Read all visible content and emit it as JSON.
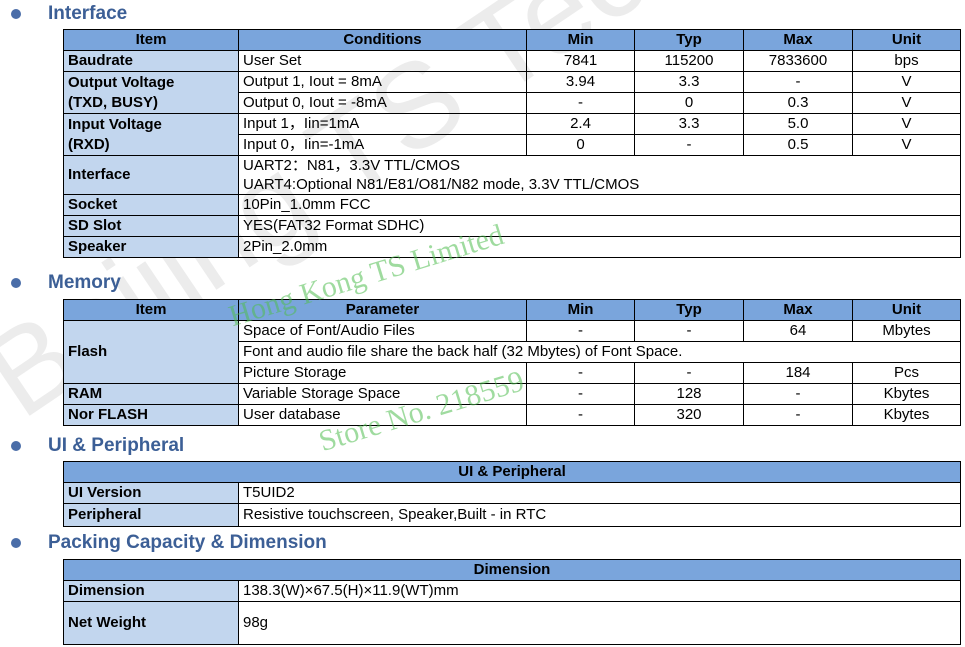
{
  "sections": {
    "interface": "Interface",
    "memory": "Memory",
    "ui": "UI & Peripheral",
    "packing": "Packing Capacity & Dimension"
  },
  "interface_table": {
    "headers": [
      "Item",
      "Conditions",
      "Min",
      "Typ",
      "Max",
      "Unit"
    ],
    "baudrate": {
      "item": "Baudrate",
      "cond": "User Set",
      "min": "7841",
      "typ": "115200",
      "max": "7833600",
      "unit": "bps"
    },
    "output_voltage": {
      "item_line1": "Output Voltage",
      "item_line2": "(TXD, BUSY)",
      "rows": [
        {
          "cond": "Output 1, Iout = 8mA",
          "min": "3.94",
          "typ": "3.3",
          "max": "-",
          "unit": "V"
        },
        {
          "cond": "Output 0, Iout = -8mA",
          "min": "-",
          "typ": "0",
          "max": "0.3",
          "unit": "V"
        }
      ]
    },
    "input_voltage": {
      "item_line1": "Input Voltage",
      "item_line2": "(RXD)",
      "rows": [
        {
          "cond": "Input 1，Iin=1mA",
          "min": "2.4",
          "typ": "3.3",
          "max": "5.0",
          "unit": "V"
        },
        {
          "cond": "Input 0，Iin=-1mA",
          "min": "0",
          "typ": "-",
          "max": "0.5",
          "unit": "V"
        }
      ]
    },
    "interface_row": {
      "item": "Interface",
      "line1": "UART2：N81，3.3V TTL/CMOS",
      "line2": "UART4:Optional N81/E81/O81/N82 mode, 3.3V TTL/CMOS"
    },
    "socket": {
      "item": "Socket",
      "value": "10Pin_1.0mm FCC"
    },
    "sd_slot": {
      "item": "SD Slot",
      "value": "YES(FAT32 Format SDHC)"
    },
    "speaker": {
      "item": "Speaker",
      "value": "2Pin_2.0mm"
    }
  },
  "memory_table": {
    "headers": [
      "Item",
      "Parameter",
      "Min",
      "Typ",
      "Max",
      "Unit"
    ],
    "flash": {
      "item": "Flash",
      "row1": {
        "param": "Space of Font/Audio Files",
        "min": "-",
        "typ": "-",
        "max": "64",
        "unit": "Mbytes"
      },
      "note": "Font and audio file share the back half (32 Mbytes) of Font Space.",
      "row3": {
        "param": "Picture Storage",
        "min": "-",
        "typ": "-",
        "max": "184",
        "unit": "Pcs"
      }
    },
    "ram": {
      "item": "RAM",
      "param": "Variable Storage Space",
      "min": "-",
      "typ": "128",
      "max": "-",
      "unit": "Kbytes"
    },
    "nor": {
      "item": "Nor FLASH",
      "param": "User database",
      "min": "-",
      "typ": "320",
      "max": "-",
      "unit": "Kbytes"
    }
  },
  "ui_table": {
    "band": "UI & Peripheral",
    "version": {
      "item": "UI Version",
      "value": "T5UID2"
    },
    "peripheral": {
      "item": "Peripheral",
      "value": "Resistive touchscreen, Speaker,Built - in RTC"
    }
  },
  "packing_table": {
    "band": "Dimension",
    "dimension": {
      "item": "Dimension",
      "value": "138.3(W)×67.5(H)×11.9(WT)mm"
    },
    "weight": {
      "item": "Net Weight",
      "value": "98g"
    }
  },
  "watermarks": {
    "line1": "Hong Kong TS Limited",
    "line2": "Store No. 218559",
    "background": "Beijing TS Technology"
  },
  "colors": {
    "header_blue": "#7aa5dc",
    "item_blue": "#c2d6ee",
    "title_blue": "#3c5f96",
    "watermark_green": "#50be50"
  }
}
